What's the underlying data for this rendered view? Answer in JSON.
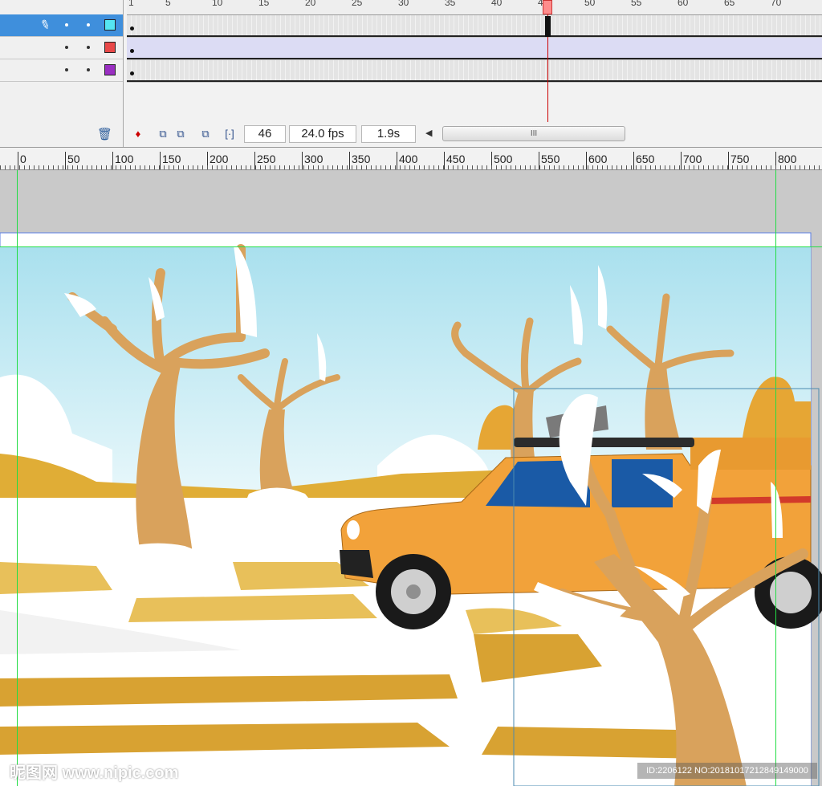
{
  "timeline": {
    "layers": [
      {
        "color": "#55e6f2",
        "selected": true
      },
      {
        "color": "#e84848",
        "selected": false
      },
      {
        "color": "#9a2fc2",
        "selected": false
      }
    ],
    "frame_numbers": [
      "1",
      "5",
      "10",
      "15",
      "20",
      "25",
      "30",
      "35",
      "40",
      "45",
      "50",
      "55",
      "60",
      "65",
      "70"
    ],
    "current_frame": "46",
    "frame_rate": "24.0 fps",
    "elapsed_time": "1.9s",
    "scroll_thumb": "III"
  },
  "stage_ruler": {
    "labels": [
      "0",
      "50",
      "100",
      "150",
      "200",
      "250",
      "300",
      "350",
      "400",
      "450",
      "500",
      "550",
      "600",
      "650",
      "700",
      "750",
      "800"
    ]
  },
  "watermark": {
    "logo_text": "昵图网 www.nipic.com",
    "id_text": "ID:2206122 NO:20181017212849149000"
  },
  "colors": {
    "selection_blue": "#3f8fdc",
    "playhead_red": "#cc0000",
    "guide_green": "#22dd44",
    "car_orange": "#f2a23a",
    "tree_tan": "#d9a25c",
    "ground_gold": "#e0ad36",
    "snow_white": "#ffffff",
    "sky_blue": "#a9e0ee"
  },
  "icons": {
    "layer_edit": "pencil-icon",
    "delete_layer": "trash-icon",
    "center_frame": "center-frame-icon",
    "onion_skin": "onion-skin-icon",
    "onion_outlines": "onion-outlines-icon",
    "edit_multiple": "edit-multiple-frames-icon",
    "onion_markers": "onion-markers-icon"
  }
}
